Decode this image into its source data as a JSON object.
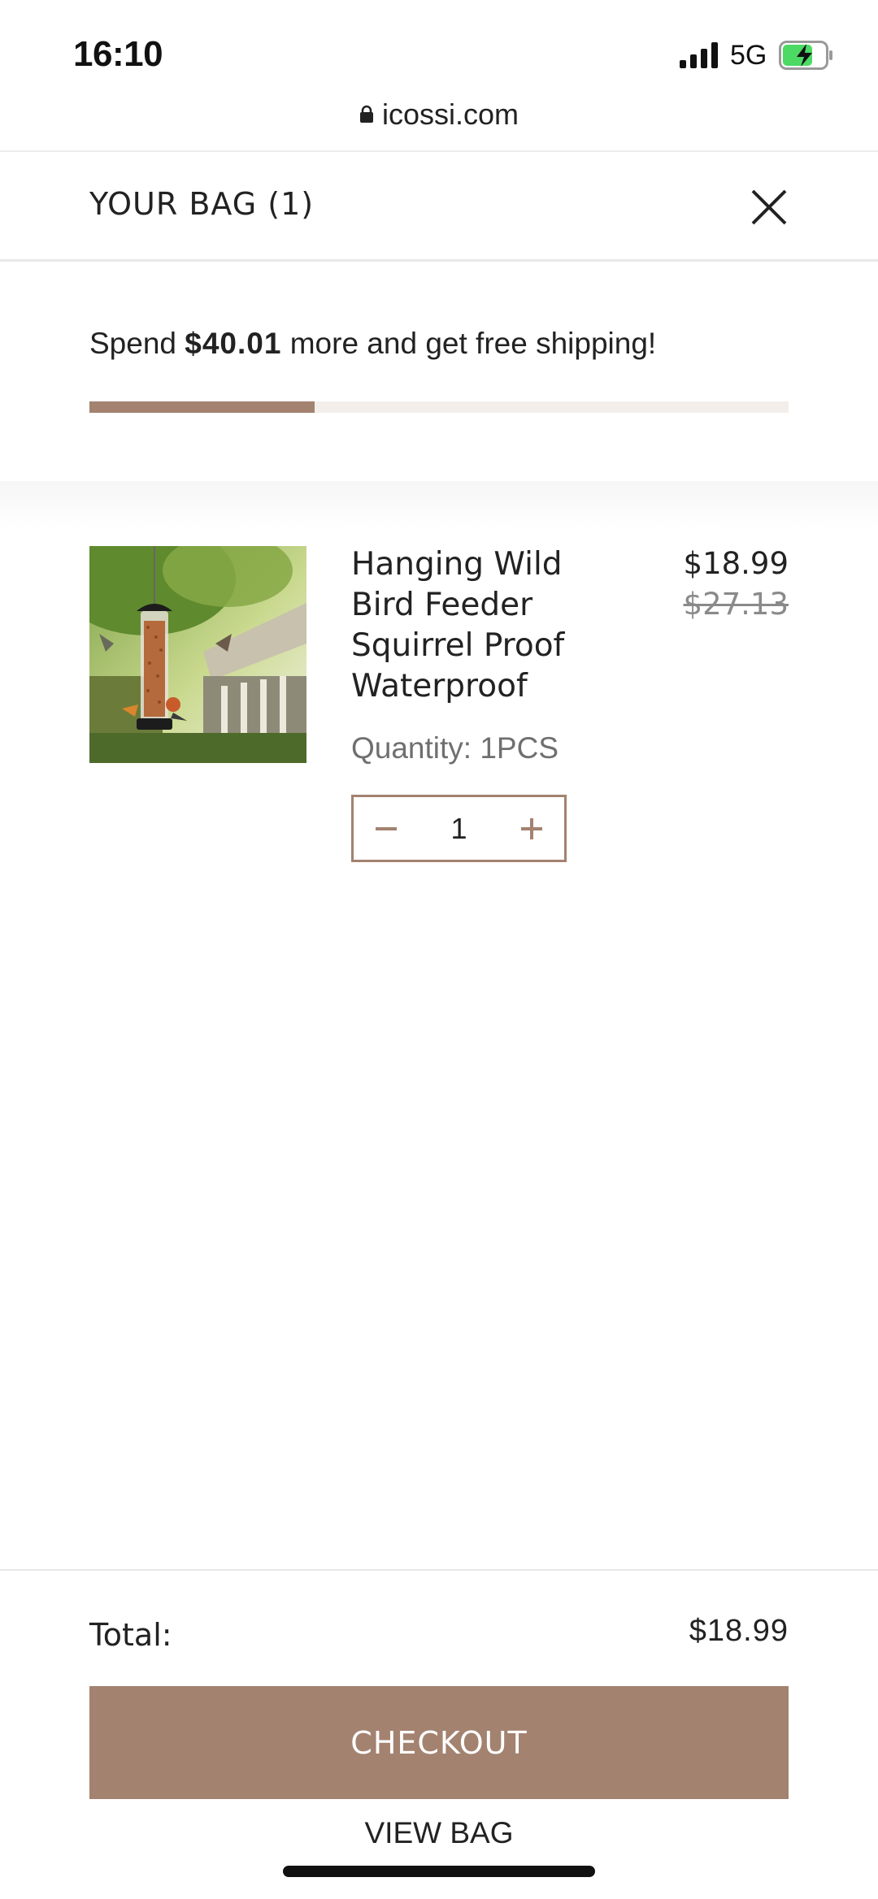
{
  "status_bar": {
    "time": "16:10",
    "network": "5G",
    "signal_icon": "cellular-signal-icon",
    "battery_icon": "battery-charging-icon"
  },
  "browser": {
    "url": "icossi.com",
    "lock_icon": "lock-icon"
  },
  "bag": {
    "title": "YOUR BAG (1)",
    "close_icon": "close-icon"
  },
  "shipping": {
    "prefix": "Spend ",
    "amount": "$40.01",
    "suffix": " more and get free shipping!",
    "progress_fraction": 0.322
  },
  "item": {
    "name": "Hanging Wild Bird Feeder Squirrel Proof Waterproof",
    "price": "$18.99",
    "original_price": "$27.13",
    "variant": "Quantity: 1PCS",
    "quantity": "1",
    "image_icon": "bird-feeder-image"
  },
  "footer": {
    "total_label": "Total:",
    "total_value": "$18.99",
    "checkout_label": "CHECKOUT",
    "view_bag_label": "VIEW BAG"
  },
  "colors": {
    "accent": "#a38270",
    "progress_track": "#f3eeea"
  }
}
